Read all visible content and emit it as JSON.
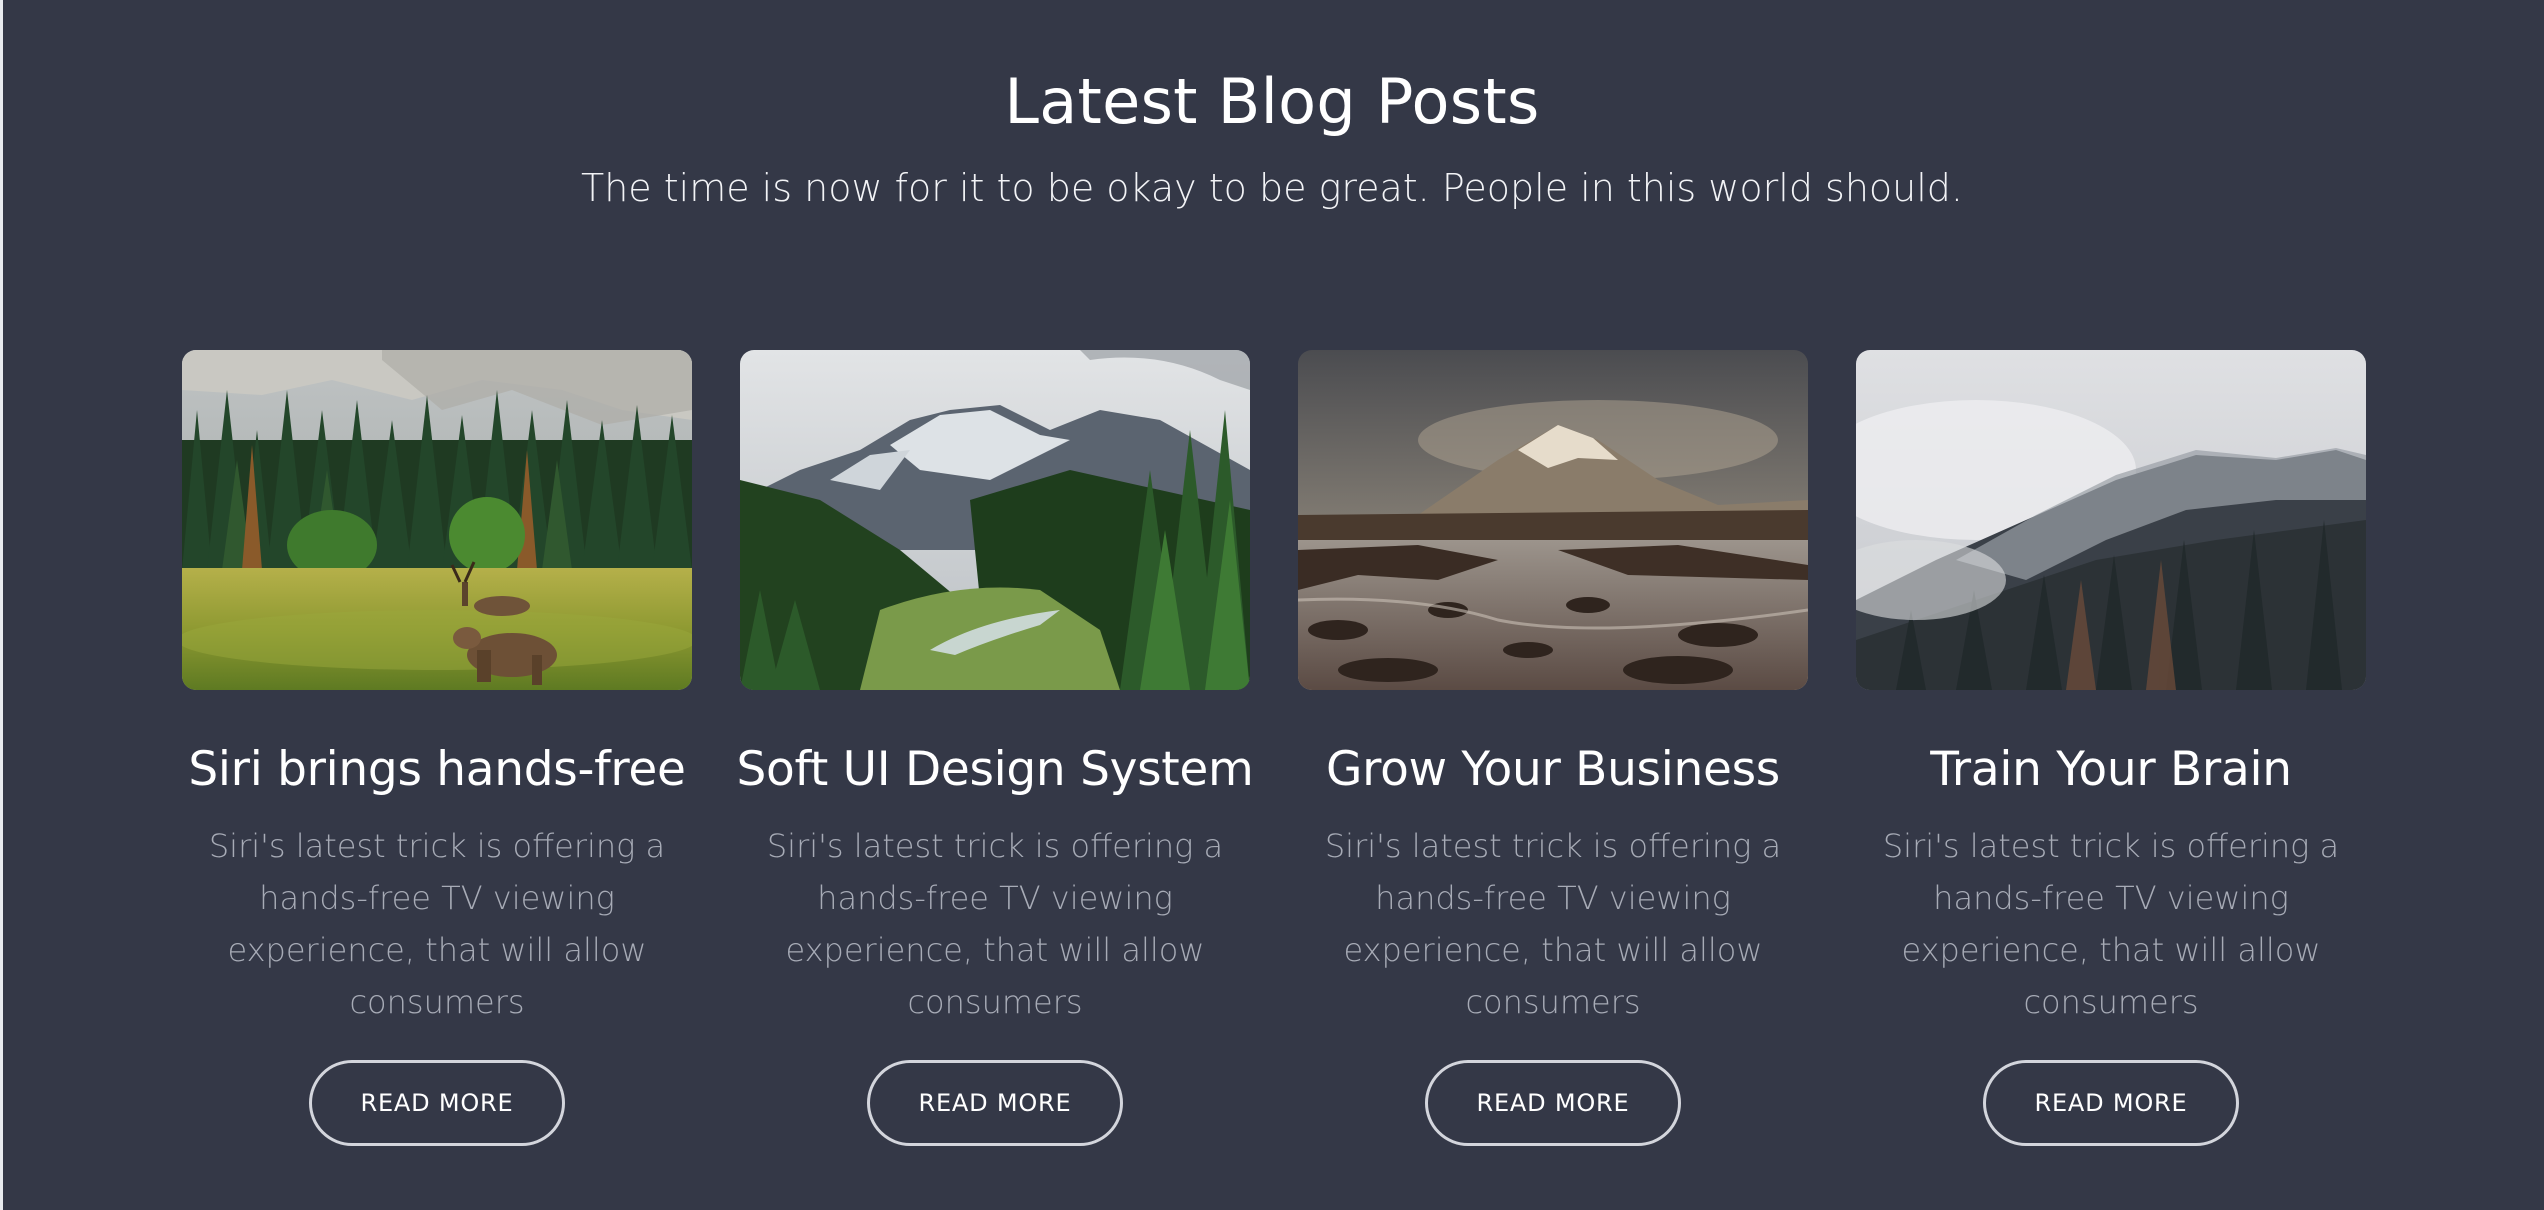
{
  "section": {
    "title": "Latest Blog Posts",
    "subtitle": "The time is now for it to be okay to be great. People in this world should."
  },
  "colors": {
    "background": "#343847",
    "title": "#ffffff",
    "description": "#a7abb6",
    "button_border": "#d3d5dc"
  },
  "posts": [
    {
      "title": "Siri brings hands-free",
      "description": "Siri's latest trick is offering a hands-free TV viewing experience, that will allow consumers",
      "button_label": "READ MORE",
      "image": "forest-deer-photo"
    },
    {
      "title": "Soft UI Design System",
      "description": "Siri's latest trick is offering a hands-free TV viewing experience, that will allow consumers",
      "button_label": "READ MORE",
      "image": "mountain-valley-photo"
    },
    {
      "title": "Grow Your Business",
      "description": "Siri's latest trick is offering a hands-free TV viewing experience, that will allow consumers",
      "button_label": "READ MORE",
      "image": "mountain-river-photo"
    },
    {
      "title": "Train Your Brain",
      "description": "Siri's latest trick is offering a hands-free TV viewing experience, that will allow consumers",
      "button_label": "READ MORE",
      "image": "misty-forest-photo"
    }
  ]
}
